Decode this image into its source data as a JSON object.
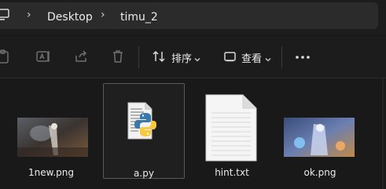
{
  "breadcrumb": {
    "items": [
      "Desktop",
      "timu_2"
    ]
  },
  "toolbar": {
    "sort_label": "排序",
    "view_label": "查看"
  },
  "files": [
    {
      "name": "1new.png",
      "type": "image"
    },
    {
      "name": "a.py",
      "type": "python"
    },
    {
      "name": "hint.txt",
      "type": "text"
    },
    {
      "name": "ok.png",
      "type": "image"
    }
  ],
  "colors": {
    "background": "#191919",
    "address_field": "#2b2b2b",
    "selection_border": "#5a5a5a"
  }
}
